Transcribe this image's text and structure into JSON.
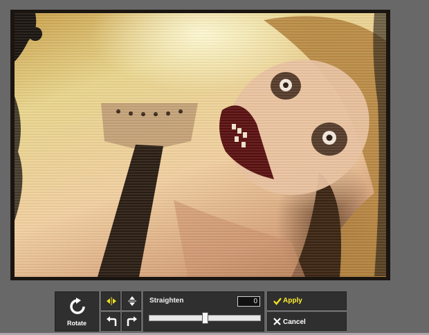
{
  "toolbar": {
    "rotate_label": "Rotate",
    "straighten_label": "Straighten",
    "straighten_value": "0",
    "straighten_level": 0.5,
    "apply_label": "Apply",
    "cancel_label": "Cancel"
  },
  "icons": {
    "rotate": "rotate-clockwise-icon",
    "flip_horizontal": "flip-horizontal-icon",
    "flip_vertical": "flip-vertical-icon",
    "rotate_left": "rotate-left-icon",
    "rotate_right": "rotate-right-icon",
    "apply": "checkmark-icon",
    "cancel": "close-icon"
  },
  "colors": {
    "background": "#686868",
    "toolbar": "#2f2f2f",
    "accent": "#ffee33"
  }
}
